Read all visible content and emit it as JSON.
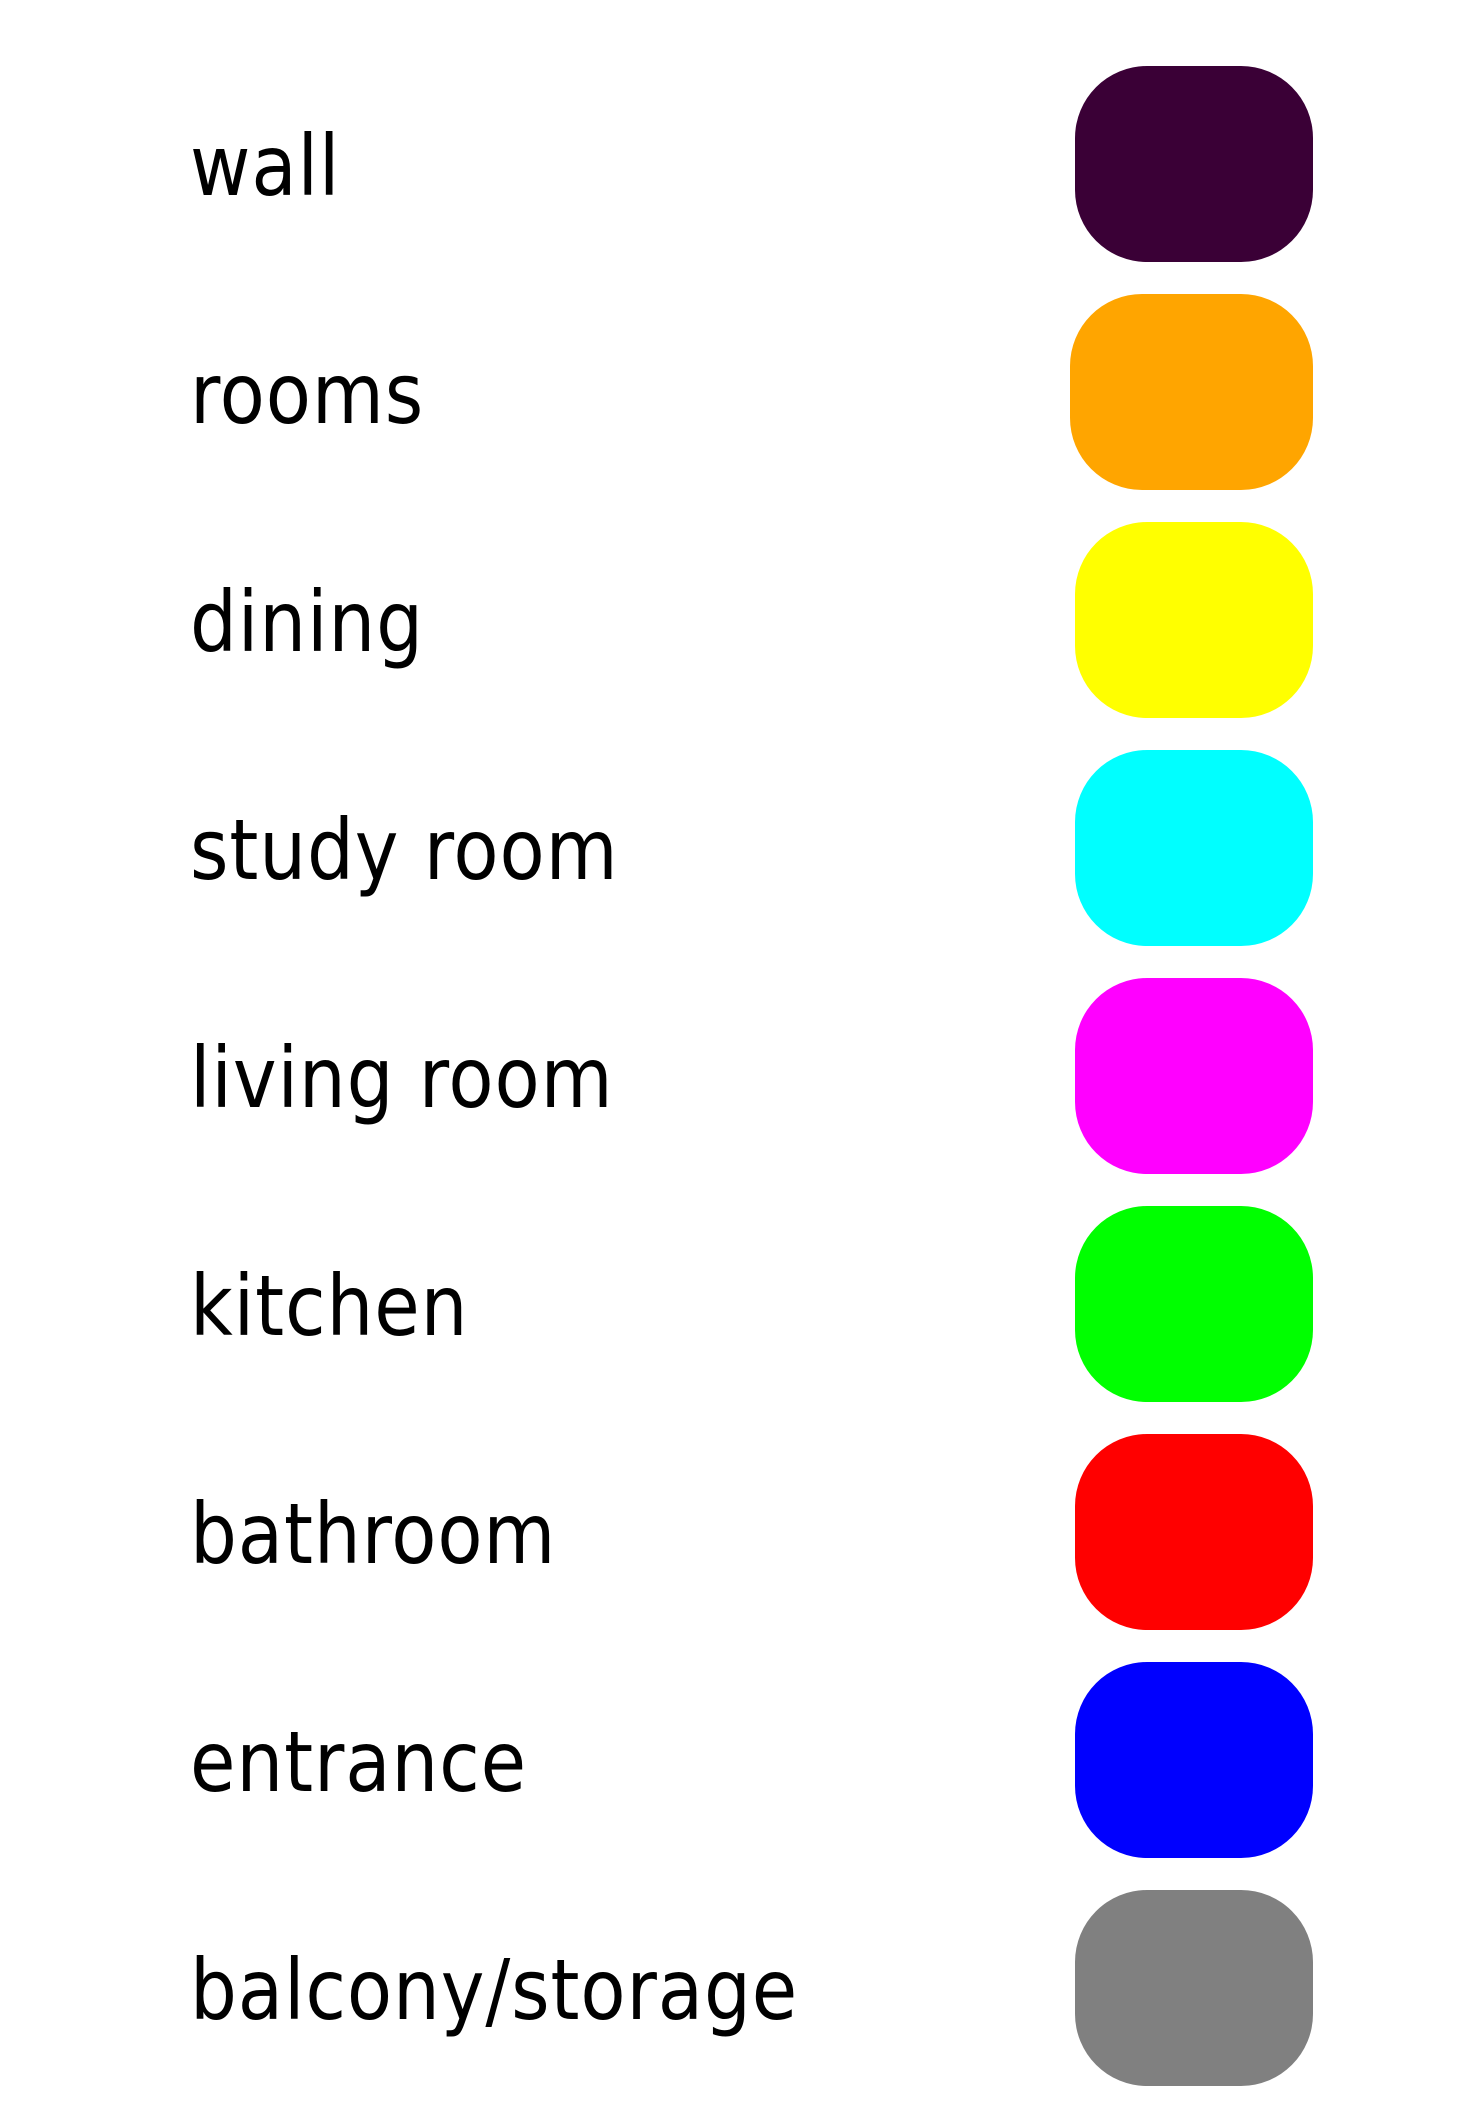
{
  "legend": {
    "items": [
      {
        "label": "wall",
        "color": "#3a0036"
      },
      {
        "label": "rooms",
        "color": "#ffa500"
      },
      {
        "label": "dining",
        "color": "#ffff00"
      },
      {
        "label": "study room",
        "color": "#00ffff"
      },
      {
        "label": "living room",
        "color": "#ff00ff"
      },
      {
        "label": "kitchen",
        "color": "#00ff00"
      },
      {
        "label": "bathroom",
        "color": "#ff0000"
      },
      {
        "label": "entrance",
        "color": "#0000ff"
      },
      {
        "label": "balcony/storage",
        "color": "#808080"
      }
    ]
  }
}
